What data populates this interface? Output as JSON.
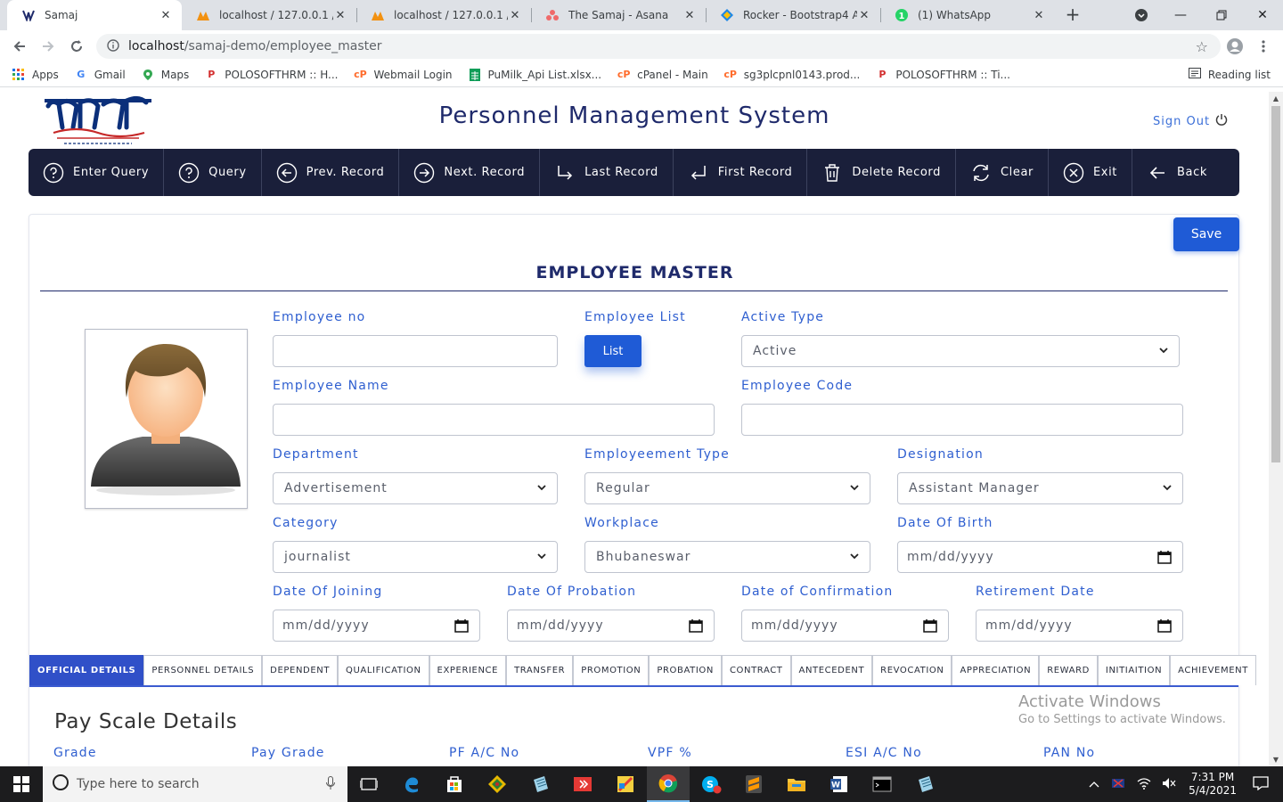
{
  "browser": {
    "tabs": [
      {
        "title": "Samaj",
        "active": true
      },
      {
        "title": "localhost / 127.0.0.1 / po"
      },
      {
        "title": "localhost / 127.0.0.1 / po"
      },
      {
        "title": "The Samaj - Asana"
      },
      {
        "title": "Rocker - Bootstrap4 Adm"
      },
      {
        "title": "(1) WhatsApp"
      }
    ],
    "url_host": "localhost",
    "url_path": "/samaj-demo/employee_master",
    "bookmarks": [
      "Apps",
      "Gmail",
      "Maps",
      "POLOSOFTHRM :: H...",
      "Webmail Login",
      "PuMilk_Api List.xlsx...",
      "cPanel - Main",
      "sg3plcpnl0143.prod...",
      "POLOSOFTHRM :: Ti..."
    ],
    "reading_list": "Reading list"
  },
  "header": {
    "app_title": "Personnel Management System",
    "sign_out": "Sign Out"
  },
  "toolbar": {
    "items": [
      {
        "label": "Enter Query",
        "icon": "question-circle-icon"
      },
      {
        "label": "Query",
        "icon": "question-circle-icon"
      },
      {
        "label": "Prev. Record",
        "icon": "arrow-left-circle-icon"
      },
      {
        "label": "Next. Record",
        "icon": "arrow-right-circle-icon"
      },
      {
        "label": "Last Record",
        "icon": "corner-down-right-icon"
      },
      {
        "label": "First Record",
        "icon": "corner-down-left-icon"
      },
      {
        "label": "Delete Record",
        "icon": "trash-icon"
      },
      {
        "label": "Clear",
        "icon": "refresh-icon"
      },
      {
        "label": "Exit",
        "icon": "x-circle-icon"
      },
      {
        "label": "Back",
        "icon": "arrow-left-icon"
      }
    ]
  },
  "form": {
    "save_label": "Save",
    "title": "EMPLOYEE MASTER",
    "employee_no_label": "Employee no",
    "employee_no_value": "",
    "employee_list_label": "Employee List",
    "list_button": "List",
    "active_type_label": "Active Type",
    "active_type_value": "Active",
    "employee_name_label": "Employee Name",
    "employee_name_value": "",
    "employee_code_label": "Employee Code",
    "employee_code_value": "",
    "department_label": "Department",
    "department_value": "Advertisement",
    "employment_type_label": "Employeement Type",
    "employment_type_value": "Regular",
    "designation_label": "Designation",
    "designation_value": "Assistant Manager",
    "category_label": "Category",
    "category_value": "journalist",
    "workplace_label": "Workplace",
    "workplace_value": "Bhubaneswar",
    "dob_label": "Date Of Birth",
    "doj_label": "Date Of Joining",
    "dop_label": "Date Of Probation",
    "doc_label": "Date of Confirmation",
    "retirement_label": "Retirement Date",
    "date_placeholder": "mm/dd/yyyy"
  },
  "tabs": [
    "OFFICIAL DETAILS",
    "PERSONNEL DETAILS",
    "DEPENDENT",
    "QUALIFICATION",
    "EXPERIENCE",
    "TRANSFER",
    "PROMOTION",
    "PROBATION",
    "CONTRACT",
    "ANTECEDENT",
    "REVOCATION",
    "APPRECIATION",
    "REWARD",
    "INITIAITION",
    "ACHIEVEMENT"
  ],
  "pay_scale": {
    "title": "Pay Scale Details",
    "fields": [
      "Grade",
      "Pay Grade",
      "PF A/C No",
      "VPF %",
      "ESI A/C No",
      "PAN No"
    ]
  },
  "watermark": {
    "line1": "Activate Windows",
    "line2": "Go to Settings to activate Windows."
  },
  "taskbar": {
    "search_placeholder": "Type here to search",
    "time": "7:31 PM",
    "date": "5/4/2021"
  },
  "colors": {
    "toolbar_bg": "#1a1f3a",
    "primary_button": "#1f5bd6",
    "label_blue": "#2f5fd0",
    "title_navy": "#1f2a6b"
  }
}
